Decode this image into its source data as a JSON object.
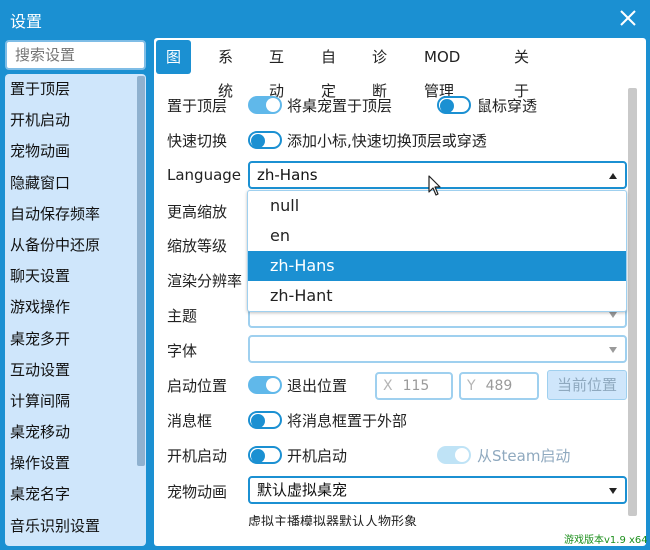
{
  "window": {
    "title": "设置",
    "close_icon": "close-icon"
  },
  "sidebar": {
    "search_placeholder": "搜索设置",
    "items": [
      "置于顶层",
      "开机启动",
      "宠物动画",
      "隐藏窗口",
      "自动保存频率",
      "从备份中还原",
      "聊天设置",
      "游戏操作",
      "桌宠多开",
      "互动设置",
      "计算间隔",
      "桌宠移动",
      "操作设置",
      "桌宠名字",
      "音乐识别设置"
    ]
  },
  "tabs": [
    "图形",
    "系统",
    "互动",
    "自定",
    "诊断",
    "MOD管理",
    "关于"
  ],
  "settings": {
    "topmost": {
      "label": "置于顶层",
      "toggle_text": "将桌宠置于顶层",
      "toggle_on": true,
      "mouse_through_text": "鼠标穿透",
      "mouse_through_on": false
    },
    "quick_switch": {
      "label": "快速切换",
      "toggle_text": "添加小标,快速切换顶层或穿透",
      "toggle_on": false
    },
    "language": {
      "label": "Language",
      "value": "zh-Hans",
      "options": [
        "null",
        "en",
        "zh-Hans",
        "zh-Hant"
      ]
    },
    "height_scale": {
      "label": "更高缩放"
    },
    "zoom_level": {
      "label": "缩放等级"
    },
    "render_resolution": {
      "label": "渲染分辨率"
    },
    "theme": {
      "label": "主题"
    },
    "font": {
      "label": "字体"
    },
    "start_position": {
      "label": "启动位置",
      "toggle_text": "退出位置",
      "toggle_on": true,
      "x_axis": "X",
      "x_value": "115",
      "y_axis": "Y",
      "y_value": "489",
      "current_button": "当前位置"
    },
    "message_box": {
      "label": "消息框",
      "toggle_text": "将消息框置于外部",
      "toggle_on": false
    },
    "autostart": {
      "label": "开机启动",
      "toggle_text": "开机启动",
      "toggle_on": false,
      "steam_text": "从Steam启动",
      "steam_on": true
    },
    "pet_animation": {
      "label": "宠物动画",
      "value": "默认虚拟桌宠",
      "description": "虚拟主播模拟器默认人物形象"
    }
  },
  "footer": {
    "version": "游戏版本v1.9 x64"
  },
  "colors": {
    "accent": "#1b90d2",
    "sidebar_bg": "#cfe6fb",
    "toggle_on": "#60b8ea",
    "version_text": "#1c8f1c"
  }
}
